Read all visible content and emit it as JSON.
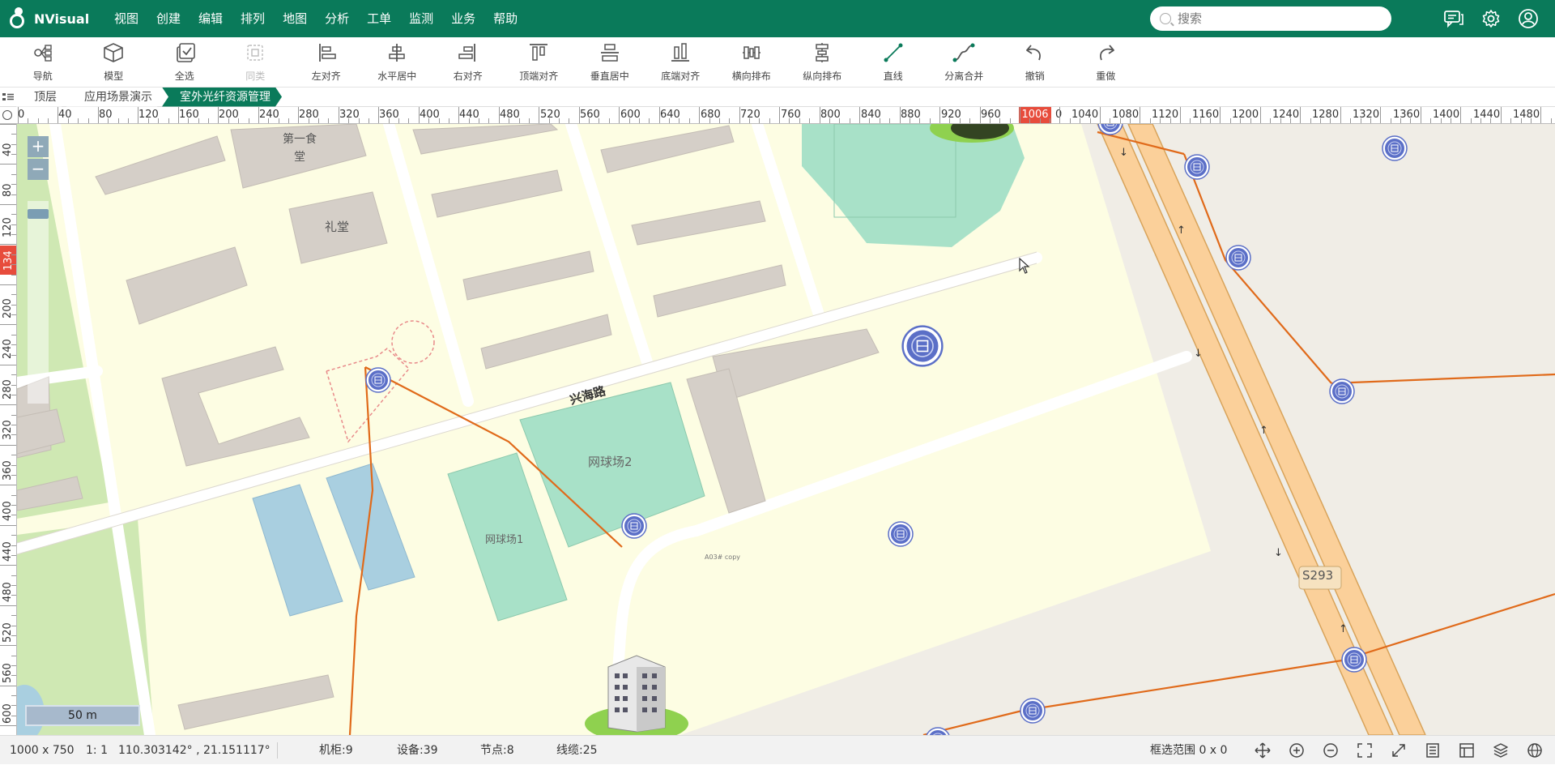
{
  "app": {
    "name": "NVisual"
  },
  "menu": [
    "视图",
    "创建",
    "编辑",
    "排列",
    "地图",
    "分析",
    "工单",
    "监测",
    "业务",
    "帮助"
  ],
  "search": {
    "placeholder": "搜索"
  },
  "top_icons": [
    "chat-icon",
    "gear-icon",
    "user-icon"
  ],
  "toolbar": [
    {
      "label": "导航",
      "icon": "nav-icon",
      "disabled": false
    },
    {
      "label": "模型",
      "icon": "cube-icon",
      "disabled": false
    },
    {
      "label": "全选",
      "icon": "select-all-icon",
      "disabled": false
    },
    {
      "label": "同类",
      "icon": "same-type-icon",
      "disabled": true
    },
    {
      "label": "左对齐",
      "icon": "align-left-icon",
      "disabled": false
    },
    {
      "label": "水平居中",
      "icon": "align-hcenter-icon",
      "disabled": false
    },
    {
      "label": "右对齐",
      "icon": "align-right-icon",
      "disabled": false
    },
    {
      "label": "顶端对齐",
      "icon": "align-top-icon",
      "disabled": false
    },
    {
      "label": "垂直居中",
      "icon": "align-vcenter-icon",
      "disabled": false
    },
    {
      "label": "底端对齐",
      "icon": "align-bottom-icon",
      "disabled": false
    },
    {
      "label": "横向排布",
      "icon": "distribute-h-icon",
      "disabled": false
    },
    {
      "label": "纵向排布",
      "icon": "distribute-v-icon",
      "disabled": false
    },
    {
      "label": "直线",
      "icon": "line-icon",
      "disabled": false
    },
    {
      "label": "分离合并",
      "icon": "split-merge-icon",
      "disabled": false
    },
    {
      "label": "撤销",
      "icon": "undo-icon",
      "disabled": false
    },
    {
      "label": "重做",
      "icon": "redo-icon",
      "disabled": false
    }
  ],
  "breadcrumb": [
    "顶层",
    "应用场景演示",
    "室外光纤资源管理"
  ],
  "ruler": {
    "h_labels": [
      "0",
      "40",
      "80",
      "120",
      "160",
      "200",
      "240",
      "280",
      "320",
      "360",
      "400",
      "440",
      "480",
      "520",
      "560",
      "600",
      "640",
      "680",
      "720",
      "760",
      "800",
      "840",
      "880",
      "920",
      "960",
      "1006",
      "0",
      "1040",
      "1080",
      "1120",
      "1160",
      "1200",
      "1240",
      "1280",
      "1320",
      "1360",
      "1400",
      "1440",
      "1480"
    ],
    "v_labels": [
      "40",
      "80",
      "120",
      "134",
      "200",
      "240",
      "280",
      "320",
      "360",
      "400",
      "440",
      "480",
      "520",
      "560",
      "600"
    ],
    "h_marker": "1006",
    "v_marker": "134"
  },
  "map_labels": {
    "canteen": "第一食堂",
    "hall": "礼堂",
    "road": "兴海路",
    "court2": "网球场2",
    "court1": "网球场1",
    "highway": "S293",
    "tag": "A03# copy"
  },
  "scale": {
    "label": "50 m"
  },
  "status": {
    "size": "1000 x 750",
    "ratio": "1: 1",
    "coords": "110.303142° , 21.151117°",
    "cabinets": "机柜:9",
    "devices": "设备:39",
    "nodes": "节点:8",
    "cables": "线缆:25",
    "selection": "框选范围 0 x 0"
  },
  "colors": {
    "brand": "#0a7a5a",
    "cable": "#e06a1a",
    "device": "#5b6fc7"
  }
}
